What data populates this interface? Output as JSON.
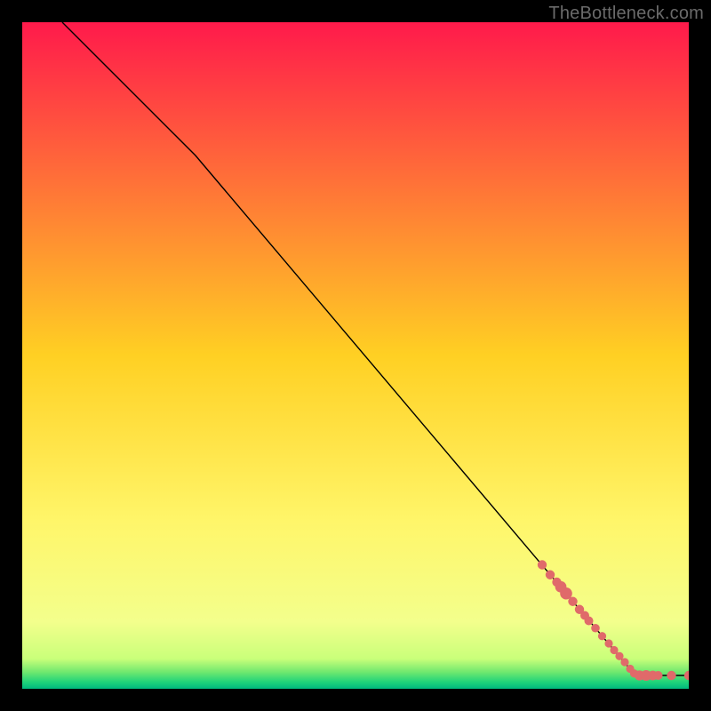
{
  "watermark": "TheBottleneck.com",
  "chart_data": {
    "type": "line",
    "title": "",
    "xlabel": "",
    "ylabel": "",
    "xlim": [
      0,
      100
    ],
    "ylim": [
      0,
      100
    ],
    "grid": false,
    "background_gradient": {
      "stops": [
        {
          "pos": 0.0,
          "color": "#ff1a4b"
        },
        {
          "pos": 0.5,
          "color": "#ffd023"
        },
        {
          "pos": 0.75,
          "color": "#fff66a"
        },
        {
          "pos": 0.9,
          "color": "#f3ff8c"
        },
        {
          "pos": 0.955,
          "color": "#c9ff7a"
        },
        {
          "pos": 0.975,
          "color": "#6fe86f"
        },
        {
          "pos": 0.99,
          "color": "#1fd37a"
        },
        {
          "pos": 1.0,
          "color": "#00b97e"
        }
      ]
    },
    "series": [
      {
        "name": "bottleneck-curve",
        "color": "#000000",
        "width": 1.4,
        "points": [
          {
            "x": 6,
            "y": 100
          },
          {
            "x": 26,
            "y": 80
          },
          {
            "x": 92,
            "y": 2
          },
          {
            "x": 100,
            "y": 2
          }
        ]
      }
    ],
    "scatter": {
      "name": "sample-points",
      "color": "#e06a6a",
      "points": [
        {
          "x": 78.0,
          "y": 18.6,
          "r": 5.2
        },
        {
          "x": 79.2,
          "y": 17.1,
          "r": 5.2
        },
        {
          "x": 80.2,
          "y": 16.0,
          "r": 5.2
        },
        {
          "x": 80.8,
          "y": 15.3,
          "r": 6.4
        },
        {
          "x": 81.6,
          "y": 14.3,
          "r": 6.8
        },
        {
          "x": 82.6,
          "y": 13.1,
          "r": 5.2
        },
        {
          "x": 83.6,
          "y": 11.9,
          "r": 5.2
        },
        {
          "x": 84.4,
          "y": 11.0,
          "r": 5.0
        },
        {
          "x": 85.0,
          "y": 10.2,
          "r": 5.0
        },
        {
          "x": 86.0,
          "y": 9.1,
          "r": 4.8
        },
        {
          "x": 87.0,
          "y": 7.9,
          "r": 4.6
        },
        {
          "x": 88.0,
          "y": 6.8,
          "r": 4.6
        },
        {
          "x": 88.8,
          "y": 5.8,
          "r": 4.6
        },
        {
          "x": 89.6,
          "y": 4.9,
          "r": 4.6
        },
        {
          "x": 90.4,
          "y": 4.0,
          "r": 4.6
        },
        {
          "x": 91.2,
          "y": 3.0,
          "r": 4.6
        },
        {
          "x": 91.8,
          "y": 2.3,
          "r": 4.6
        },
        {
          "x": 92.6,
          "y": 2.0,
          "r": 5.6
        },
        {
          "x": 93.6,
          "y": 2.0,
          "r": 6.0
        },
        {
          "x": 94.6,
          "y": 2.0,
          "r": 5.4
        },
        {
          "x": 95.4,
          "y": 2.0,
          "r": 5.0
        },
        {
          "x": 97.4,
          "y": 2.0,
          "r": 5.2
        },
        {
          "x": 100.0,
          "y": 2.0,
          "r": 5.2
        }
      ]
    }
  }
}
